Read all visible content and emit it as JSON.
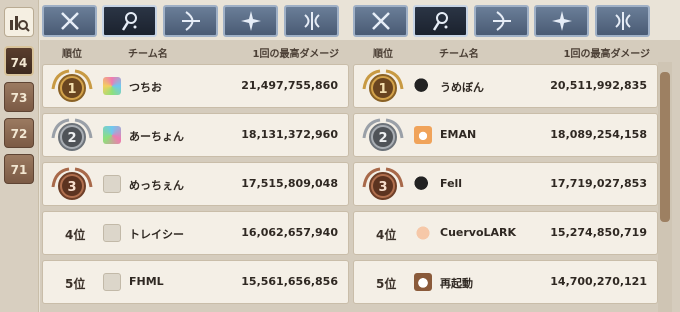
{
  "sidebar": {
    "seasons": [
      "74",
      "73",
      "72",
      "71"
    ],
    "active_season": "74"
  },
  "tabs": [
    {
      "icon": "crossed-swords-icon"
    },
    {
      "icon": "magic-staff-icon",
      "selected": true
    },
    {
      "icon": "bow-icon"
    },
    {
      "icon": "cross-compass-icon"
    },
    {
      "icon": "winged-blade-icon"
    }
  ],
  "columns": {
    "rank": "順位",
    "team": "チーム名",
    "damage": "1回の最高ダメージ"
  },
  "left_table": [
    {
      "rank": "1",
      "name": "つちお",
      "damage": "21,497,755,860",
      "avatar": "colorful"
    },
    {
      "rank": "2",
      "name": "あーちょん",
      "damage": "18,131,372,960",
      "avatar": "colorful"
    },
    {
      "rank": "3",
      "name": "めっちぇん",
      "damage": "17,515,809,048",
      "avatar": "gray"
    },
    {
      "rank": "4位",
      "name": "トレイシー",
      "damage": "16,062,657,940",
      "avatar": "gray"
    },
    {
      "rank": "5位",
      "name": "FHML",
      "damage": "15,561,656,856",
      "avatar": "gray"
    }
  ],
  "right_table": [
    {
      "rank": "1",
      "name": "うめぼん",
      "damage": "20,511,992,835",
      "avatar": "dark"
    },
    {
      "rank": "2",
      "name": "EMAN",
      "damage": "18,089,254,158",
      "avatar": "fox"
    },
    {
      "rank": "3",
      "name": "Fell",
      "damage": "17,719,027,853",
      "avatar": "dark"
    },
    {
      "rank": "4位",
      "name": "CuervoLARK",
      "damage": "15,274,850,719",
      "avatar": "peach"
    },
    {
      "rank": "5位",
      "name": "再起動",
      "damage": "14,700,270,121",
      "avatar": "cat"
    }
  ],
  "colors": {
    "gold": "#d3a24a",
    "silver": "#a9aeb4",
    "bronze": "#b06f4e",
    "tab_blue": "#55677f"
  }
}
